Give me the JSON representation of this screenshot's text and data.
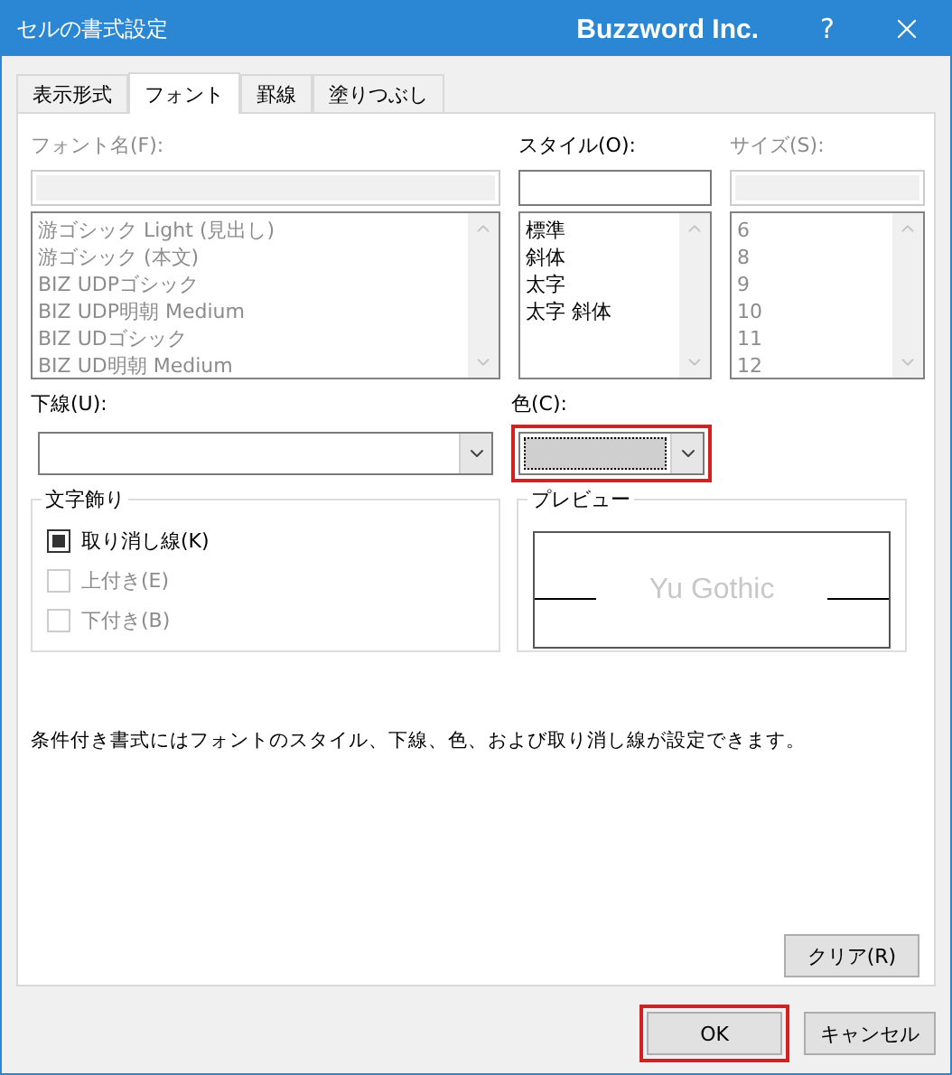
{
  "window": {
    "title": "セルの書式設定",
    "brand": "Buzzword Inc.",
    "help": "?"
  },
  "tabs": [
    {
      "label": "表示形式",
      "selected": false
    },
    {
      "label": "フォント",
      "selected": true
    },
    {
      "label": "罫線",
      "selected": false
    },
    {
      "label": "塗りつぶし",
      "selected": false
    }
  ],
  "font_name": {
    "label": "フォント名(F):",
    "disabled": true,
    "items": [
      "游ゴシック Light (見出し)",
      "游ゴシック (本文)",
      "BIZ UDPゴシック",
      "BIZ UDP明朝 Medium",
      "BIZ UDゴシック",
      "BIZ UD明朝 Medium"
    ]
  },
  "style": {
    "label": "スタイル(O):",
    "disabled": false,
    "items": [
      "標準",
      "斜体",
      "太字",
      "太字 斜体"
    ]
  },
  "size": {
    "label": "サイズ(S):",
    "disabled": true,
    "items": [
      "6",
      "8",
      "9",
      "10",
      "11",
      "12"
    ]
  },
  "underline": {
    "label": "下線(U):"
  },
  "color": {
    "label": "色(C):",
    "highlighted": true
  },
  "effects": {
    "title": "文字飾り",
    "options": [
      {
        "label": "取り消し線(K)",
        "checked": true,
        "disabled": false
      },
      {
        "label": "上付き(E)",
        "checked": false,
        "disabled": true
      },
      {
        "label": "下付き(B)",
        "checked": false,
        "disabled": true
      }
    ]
  },
  "preview": {
    "title": "プレビュー",
    "sample": "Yu Gothic"
  },
  "note": "条件付き書式にはフォントのスタイル、下線、色、および取り消し線が設定できます。",
  "clear_button": {
    "label": "クリア(R)"
  },
  "buttons": [
    {
      "label": "OK",
      "highlighted": true
    },
    {
      "label": "キャンセル",
      "highlighted": false
    }
  ]
}
